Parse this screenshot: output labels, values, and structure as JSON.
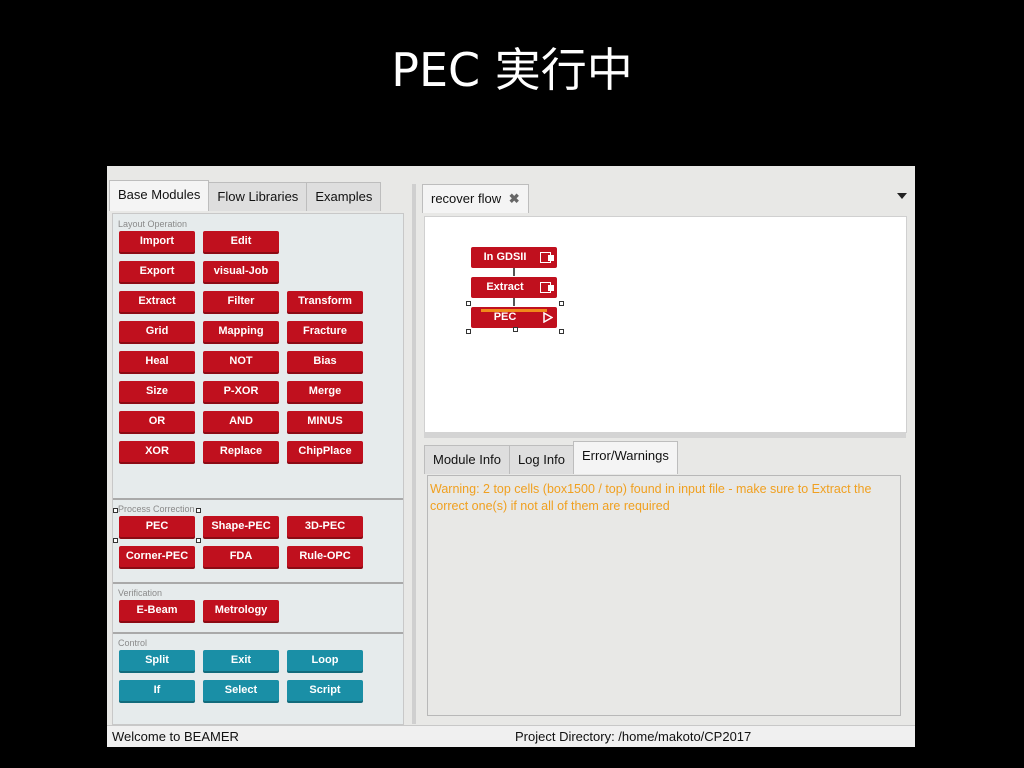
{
  "slide": {
    "title": "PEC 実行中"
  },
  "left_tabs": [
    "Base Modules",
    "Flow Libraries",
    "Examples"
  ],
  "sections": {
    "layout": "Layout Operation",
    "process": "Process Correction",
    "verification": "Verification",
    "control": "Control"
  },
  "layout_buttons": [
    "Import",
    "Edit",
    "Export",
    "visual-Job",
    "Extract",
    "Filter",
    "Transform",
    "Grid",
    "Mapping",
    "Fracture",
    "Heal",
    "NOT",
    "Bias",
    "Size",
    "P-XOR",
    "Merge",
    "OR",
    "AND",
    "MINUS",
    "XOR",
    "Replace",
    "ChipPlace"
  ],
  "process_buttons": [
    "PEC",
    "Shape-PEC",
    "3D-PEC",
    "Corner-PEC",
    "FDA",
    "Rule-OPC"
  ],
  "verification_buttons": [
    "E-Beam",
    "Metrology"
  ],
  "control_buttons": [
    "Split",
    "Exit",
    "Loop",
    "If",
    "Select",
    "Script"
  ],
  "flow_tab": {
    "label": "recover flow"
  },
  "flow_nodes": [
    "In GDSII",
    "Extract",
    "PEC"
  ],
  "bottom_tabs": [
    "Module Info",
    "Log Info",
    "Error/Warnings"
  ],
  "log": {
    "message": "Warning: 2 top cells (box1500 / top) found in input file - make sure to Extract the correct one(s) if not all of them are required"
  },
  "status": {
    "left": "Welcome to BEAMER",
    "right": "Project Directory: /home/makoto/CP2017"
  },
  "colors": {
    "module_red": "#c0101e",
    "control_teal": "#1a8fa6",
    "warning_text": "#f0a020"
  }
}
